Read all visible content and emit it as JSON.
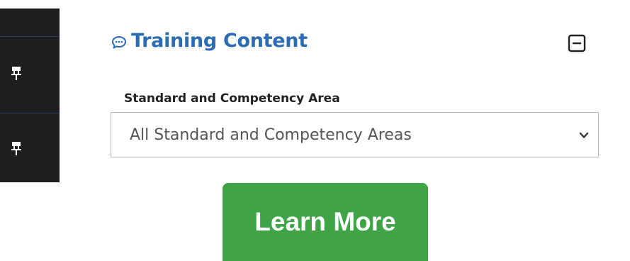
{
  "panel": {
    "title": "Training Content",
    "title_icon": "chat-bubble-icon",
    "collapse_icon": "minus-square-icon"
  },
  "filter": {
    "label": "Standard and Competency Area",
    "selected": "All Standard and Competency Areas",
    "chevron_icon": "chevron-down-icon"
  },
  "sidebar": {
    "items": [
      {
        "icon": "pin-icon"
      },
      {
        "icon": "pin-icon"
      }
    ]
  },
  "cta": {
    "label": "Learn More"
  },
  "colors": {
    "accent": "#2b6cb3",
    "rail_bg": "#1e1e1e",
    "cta_green": "#3fa445"
  }
}
